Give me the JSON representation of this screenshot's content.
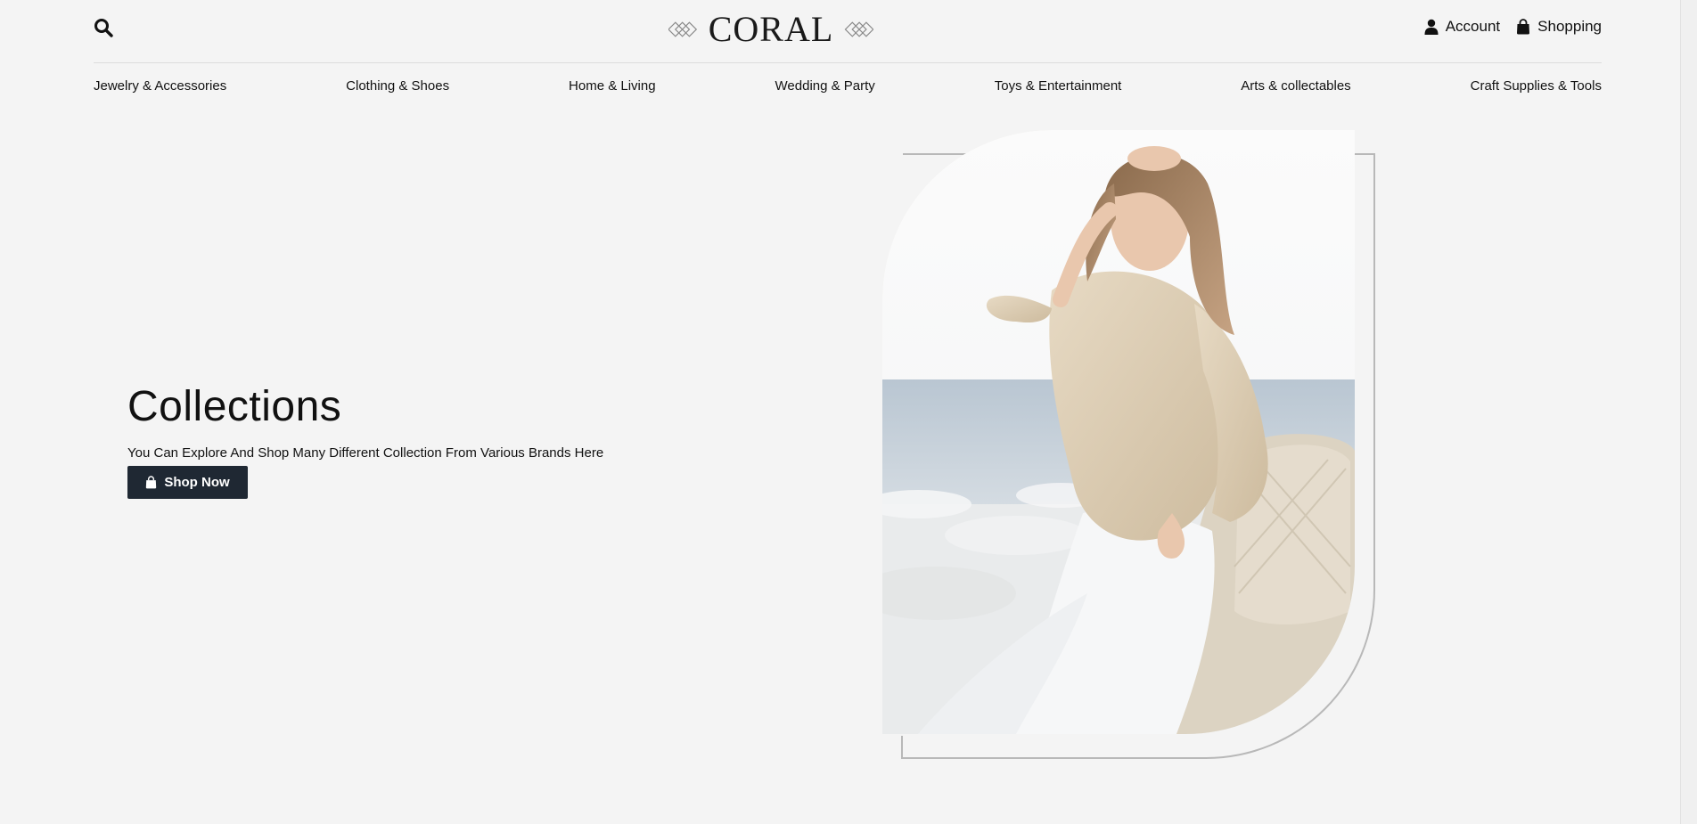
{
  "brand": {
    "name": "CORAL"
  },
  "header": {
    "account_label": "Account",
    "shopping_label": "Shopping"
  },
  "nav": {
    "items": [
      "Jewelry & Accessories",
      "Clothing & Shoes",
      "Home & Living",
      "Wedding & Party",
      "Toys & Entertainment",
      "Arts & collectables",
      "Craft Supplies & Tools"
    ]
  },
  "hero": {
    "title": "Collections",
    "subtitle": "You Can Explore And Shop Many Different Collection From Various Brands Here",
    "cta_label": "Shop Now"
  },
  "icons": {
    "search": "search-icon",
    "account": "user-icon",
    "shopping": "shopping-bag-icon",
    "logo_ornament": "diamond-ornament-icon"
  },
  "colors": {
    "background": "#f4f4f4",
    "button": "#1f2833",
    "button_text": "#ffffff",
    "frame": "#b8b8b8"
  }
}
